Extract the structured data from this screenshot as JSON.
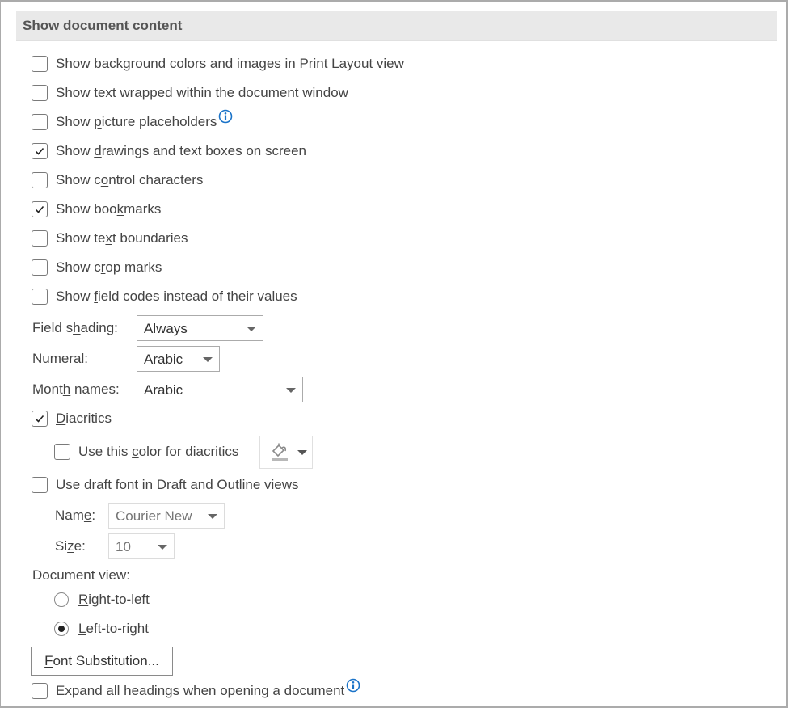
{
  "section": {
    "title": "Show document content"
  },
  "checkboxes": [
    {
      "pre": "Show ",
      "key": "b",
      "post": "ackground colors and images in Print Layout view",
      "checked": false,
      "info": false
    },
    {
      "pre": "Show text ",
      "key": "w",
      "post": "rapped within the document window",
      "checked": false,
      "info": false
    },
    {
      "pre": "Show ",
      "key": "p",
      "post": "icture placeholders",
      "checked": false,
      "info": true
    },
    {
      "pre": "Show ",
      "key": "d",
      "post": "rawings and text boxes on screen",
      "checked": true,
      "info": false
    },
    {
      "pre": "Show c",
      "key": "o",
      "post": "ntrol characters",
      "checked": false,
      "info": false
    },
    {
      "pre": "Show boo",
      "key": "k",
      "post": "marks",
      "checked": true,
      "info": false
    },
    {
      "pre": "Show te",
      "key": "x",
      "post": "t boundaries",
      "checked": false,
      "info": false
    },
    {
      "pre": "Show c",
      "key": "r",
      "post": "op marks",
      "checked": false,
      "info": false
    },
    {
      "pre": "Show ",
      "key": "f",
      "post": "ield codes instead of their values",
      "checked": false,
      "info": false
    }
  ],
  "field_shading": {
    "pre": "Field s",
    "key": "h",
    "post": "ading:",
    "value": "Always"
  },
  "numeral": {
    "pre": "",
    "key": "N",
    "post": "umeral:",
    "value": "Arabic"
  },
  "month_names": {
    "pre": "Mont",
    "key": "h",
    "post": " names:",
    "value": "Arabic"
  },
  "diacritics": {
    "pre": "",
    "key": "D",
    "post": "iacritics",
    "checked": true
  },
  "diacritics_color": {
    "pre": "Use this ",
    "key": "c",
    "post": "olor for diacritics",
    "checked": false,
    "icon": "paint-bucket-icon"
  },
  "draft_font": {
    "pre": "Use ",
    "key": "d",
    "post": "raft font in Draft and Outline views",
    "checked": false
  },
  "draft_name": {
    "pre": "Nam",
    "key": "e",
    "post": ":",
    "value": "Courier New",
    "disabled": true
  },
  "draft_size": {
    "pre": "Si",
    "key": "z",
    "post": "e:",
    "value": "10",
    "disabled": true
  },
  "document_view": {
    "label": "Document view:",
    "options": [
      {
        "pre": "",
        "key": "R",
        "post": "ight-to-left",
        "selected": false
      },
      {
        "pre": "",
        "key": "L",
        "post": "eft-to-right",
        "selected": true
      }
    ]
  },
  "font_substitution": {
    "pre": "",
    "key": "F",
    "post": "ont Substitution..."
  },
  "expand_headings": {
    "pre": "Expand all headings when opening a document",
    "key": "",
    "post": "",
    "checked": false,
    "info": true
  },
  "colors": {
    "info_blue": "#1a73c8",
    "header_bg": "#e9e9e9"
  }
}
